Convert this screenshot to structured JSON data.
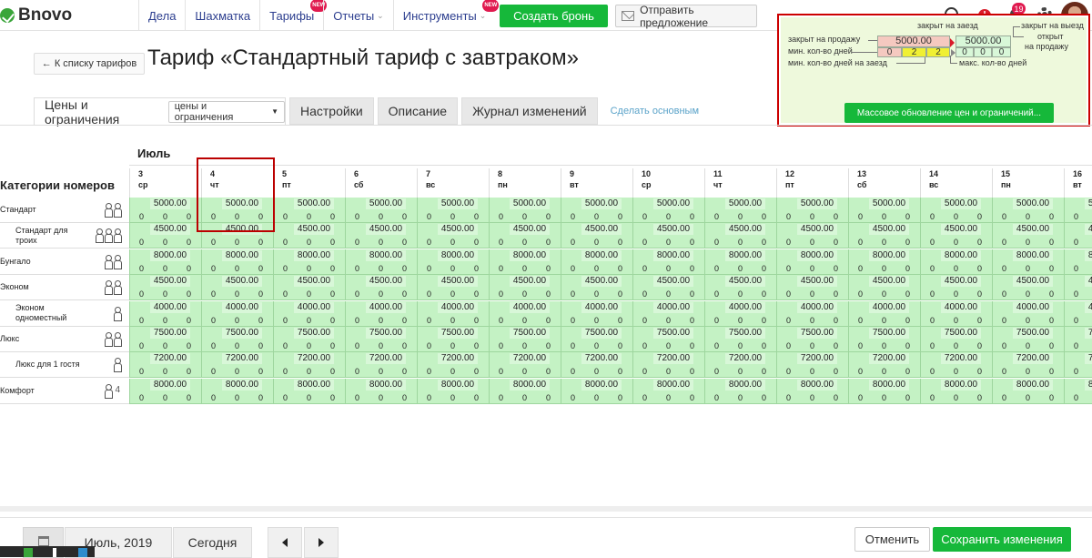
{
  "app": {
    "logo_text": "Bnovo"
  },
  "nav": [
    {
      "label": "Дела",
      "caret": false,
      "new": false
    },
    {
      "label": "Шахматка",
      "caret": false,
      "new": false
    },
    {
      "label": "Тарифы",
      "caret": false,
      "new": true
    },
    {
      "label": "Отчеты",
      "caret": true,
      "new": false
    },
    {
      "label": "Инструменты",
      "caret": true,
      "new": true
    }
  ],
  "new_badge": "NEW",
  "topbar": {
    "create_booking": "Создать бронь",
    "send_offer": "Отправить предложение",
    "alert": "!",
    "notifications_count": "19"
  },
  "page": {
    "back": "← К списку тарифов",
    "title": "Тариф «Стандартный тариф с завтраком»"
  },
  "tabs": {
    "main": "Цены и ограничения",
    "select": "цены и ограничения",
    "settings": "Настройки",
    "description": "Описание",
    "log": "Журнал изменений",
    "make_main": "Сделать основным"
  },
  "legend": {
    "closed_arrival": "закрыт на заезд",
    "closed_departure": "закрыт на выезд",
    "closed_sale": "закрыт на продажу",
    "min_days": "мин. кол-во дней",
    "min_days_arrival": "мин. кол-во дней на заезд",
    "open_sale_1": "открыт",
    "open_sale_2": "на продажу",
    "max_days": "макс. кол-во дней",
    "price_a": "5000.00",
    "price_b": "5000.00",
    "vals_a": [
      "0",
      "2",
      "2"
    ],
    "vals_b": [
      "0",
      "0",
      "0"
    ],
    "mass_update": "Массовое обновление цен и ограничений..."
  },
  "grid": {
    "month": "Июль",
    "categories_header": "Категории номеров",
    "days": [
      {
        "num": "3",
        "dow": "ср"
      },
      {
        "num": "4",
        "dow": "чт"
      },
      {
        "num": "5",
        "dow": "пт"
      },
      {
        "num": "6",
        "dow": "сб"
      },
      {
        "num": "7",
        "dow": "вс"
      },
      {
        "num": "8",
        "dow": "пн"
      },
      {
        "num": "9",
        "dow": "вт"
      },
      {
        "num": "10",
        "dow": "ср"
      },
      {
        "num": "11",
        "dow": "чт"
      },
      {
        "num": "12",
        "dow": "пт"
      },
      {
        "num": "13",
        "dow": "сб"
      },
      {
        "num": "14",
        "dow": "вс"
      },
      {
        "num": "15",
        "dow": "пн"
      },
      {
        "num": "16",
        "dow": "вт"
      }
    ],
    "rows": [
      {
        "label": "Стандарт",
        "sub": false,
        "persons": 2,
        "count": "",
        "price": "5000.00"
      },
      {
        "label": "Стандарт для троих",
        "sub": true,
        "persons": 3,
        "count": "",
        "price": "4500.00"
      },
      {
        "label": "Бунгало",
        "sub": false,
        "persons": 2,
        "count": "",
        "price": "8000.00"
      },
      {
        "label": "Эконом",
        "sub": false,
        "persons": 2,
        "count": "",
        "price": "4500.00"
      },
      {
        "label": "Эконом одноместный",
        "sub": true,
        "persons": 1,
        "count": "",
        "price": "4000.00"
      },
      {
        "label": "Люкс",
        "sub": false,
        "persons": 2,
        "count": "",
        "price": "7500.00"
      },
      {
        "label": "Люкс для 1 гостя",
        "sub": true,
        "persons": 1,
        "count": "",
        "price": "7200.00"
      },
      {
        "label": "Комфорт",
        "sub": false,
        "persons": 1,
        "count": "4",
        "price": "8000.00"
      }
    ],
    "zero": "0"
  },
  "bottom": {
    "month": "Июль, 2019",
    "today": "Сегодня",
    "cancel": "Отменить",
    "save": "Сохранить изменения"
  },
  "colors": {
    "accent_green": "#16b83a",
    "cell_green": "#c4f2c4",
    "highlight_red": "#c00",
    "nav_blue": "#2c3e8f"
  }
}
